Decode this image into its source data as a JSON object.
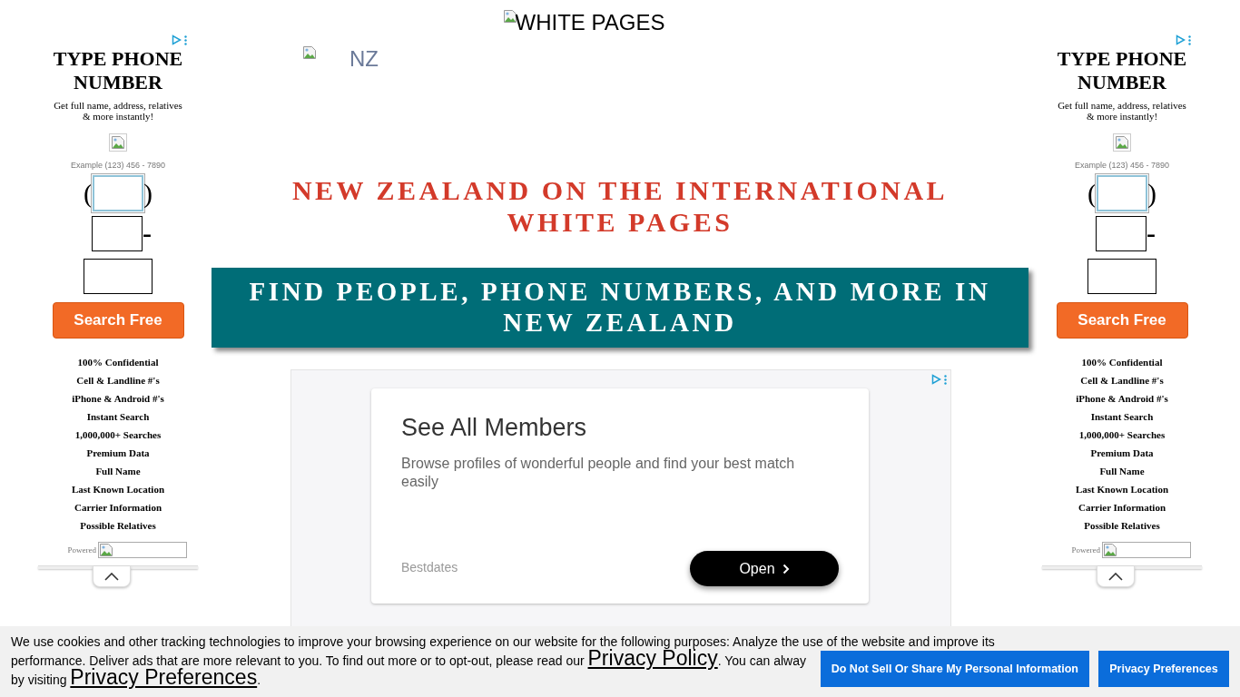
{
  "header": {
    "logo_alt": "WHITE PAGES",
    "flag_alt": "NZ"
  },
  "side_ads": [
    {
      "title": "TYPE PHONE NUMBER",
      "subtitle": "Get full name, address, relatives & more instantly!",
      "example": "Example (123) 456 - 7890",
      "open_paren": "(",
      "close_paren": ")",
      "dash": "-",
      "button": "Search Free",
      "features": [
        "100% Confidential",
        "Cell & Landline #'s",
        "iPhone & Android #'s",
        "Instant Search",
        "1,000,000+ Searches",
        "Premium Data",
        "Full Name",
        "Last Known Location",
        "Carrier Information",
        "Possible Relatives"
      ],
      "powered": "Powered"
    },
    {
      "title": "TYPE PHONE NUMBER",
      "subtitle": "Get full name, address, relatives & more instantly!",
      "example": "Example (123) 456 - 7890",
      "open_paren": "(",
      "close_paren": ")",
      "dash": "-",
      "button": "Search Free",
      "features": [
        "100% Confidential",
        "Cell & Landline #'s",
        "iPhone & Android #'s",
        "Instant Search",
        "1,000,000+ Searches",
        "Premium Data",
        "Full Name",
        "Last Known Location",
        "Carrier Information",
        "Possible Relatives"
      ],
      "powered": "Powered"
    }
  ],
  "title": "NEW ZEALAND ON THE INTERNATIONAL WHITE PAGES",
  "banner": "FIND PEOPLE, PHONE NUMBERS, AND MORE IN NEW ZEALAND",
  "ad": {
    "title": "See All Members",
    "body": "Browse profiles of wonderful people and find your best match easily",
    "advertiser": "Bestdates",
    "button": "Open"
  },
  "cookie_bar": {
    "text_before": "We use cookies and other tracking technologies to improve your browsing experience on our website for the following purposes: Analyze the use of the website and improve its",
    "text_line2": "performance. Deliver ads that are more relevant to you. To find out more or to opt-out, please read our",
    "policy_link": "Privacy Policy",
    "text_after": ". You can alway",
    "text_line3": "by visiting",
    "preferences_link": "Privacy Preferences",
    "end": ".",
    "buttons": [
      "Do Not Sell Or Share My Personal Information",
      "Privacy Preferences"
    ]
  }
}
